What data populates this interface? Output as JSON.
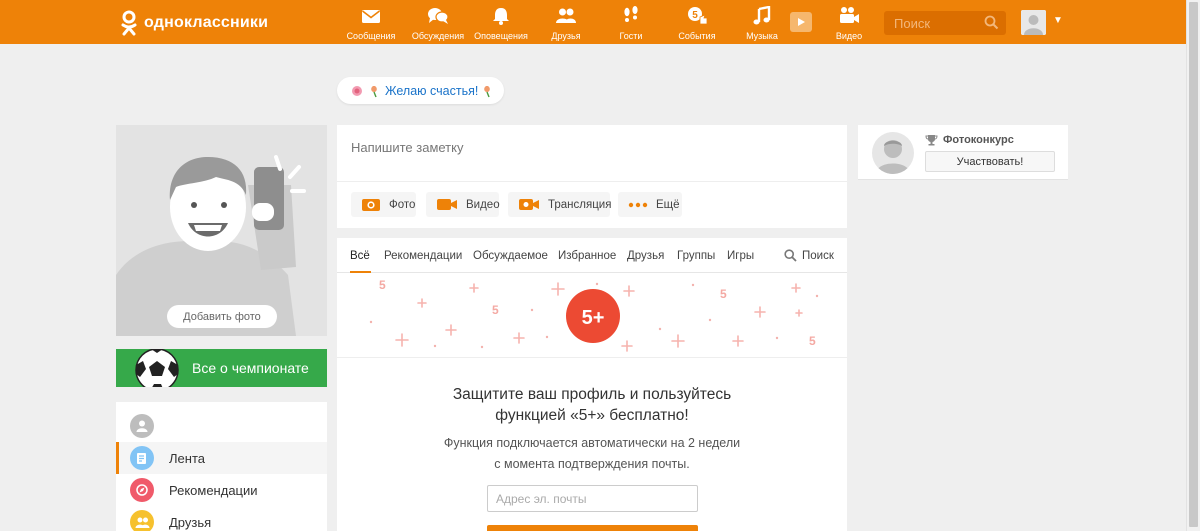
{
  "colors": {
    "accent": "#ee8208",
    "link": "#1a73c9",
    "badge": "#ec4a33",
    "football": "#36a94a"
  },
  "header": {
    "logo_text": "одноклассники",
    "nav": [
      {
        "label": "Сообщения",
        "icon": "envelope-icon"
      },
      {
        "label": "Обсуждения",
        "icon": "chat-bubbles-icon"
      },
      {
        "label": "Оповещения",
        "icon": "bell-icon"
      },
      {
        "label": "Друзья",
        "icon": "friends-icon"
      },
      {
        "label": "Гости",
        "icon": "footprints-icon"
      },
      {
        "label": "События",
        "icon": "events-icon",
        "badge": "5"
      },
      {
        "label": "Музыка",
        "icon": "music-note-icon"
      },
      {
        "label": "Видео",
        "icon": "video-camera-icon"
      }
    ],
    "search_placeholder": "Поиск"
  },
  "status": {
    "text": "Желаю счастья!"
  },
  "profile": {
    "add_photo_label": "Добавить фото"
  },
  "football_banner": {
    "label": "Все о чемпионате"
  },
  "left_menu": {
    "items": [
      {
        "label": "",
        "icon": "user-icon",
        "color": "#bdbdbd"
      },
      {
        "label": "Лента",
        "icon": "feed-icon",
        "color": "#82c4f5",
        "active": true
      },
      {
        "label": "Рекомендации",
        "icon": "compass-icon",
        "color": "#f05a6a"
      },
      {
        "label": "Друзья",
        "icon": "friends-icon",
        "color": "#f6c12e"
      }
    ]
  },
  "composer": {
    "placeholder": "Напишите заметку",
    "buttons": [
      {
        "label": "Фото",
        "icon": "camera-icon"
      },
      {
        "label": "Видео",
        "icon": "video-icon"
      },
      {
        "label": "Трансляция",
        "icon": "broadcast-icon"
      },
      {
        "label": "Ещё",
        "icon": "more-dots-icon"
      }
    ]
  },
  "feed": {
    "tabs": [
      "Всё",
      "Рекомендации",
      "Обсуждаемое",
      "Избранное",
      "Друзья",
      "Группы",
      "Игры"
    ],
    "active_tab": "Всё",
    "search_label": "Поиск",
    "promo": {
      "badge": "5+",
      "title_line1": "Защитите ваш профиль и пользуйтесь",
      "title_line2": "функцией «5+» бесплатно!",
      "subtitle_line1": "Функция подключается автоматически на 2 недели",
      "subtitle_line2": "с момента подтверждения почты.",
      "email_placeholder": "Адрес эл. почты"
    }
  },
  "contest": {
    "title": "Фотоконкурс",
    "button_label": "Участвовать!"
  }
}
